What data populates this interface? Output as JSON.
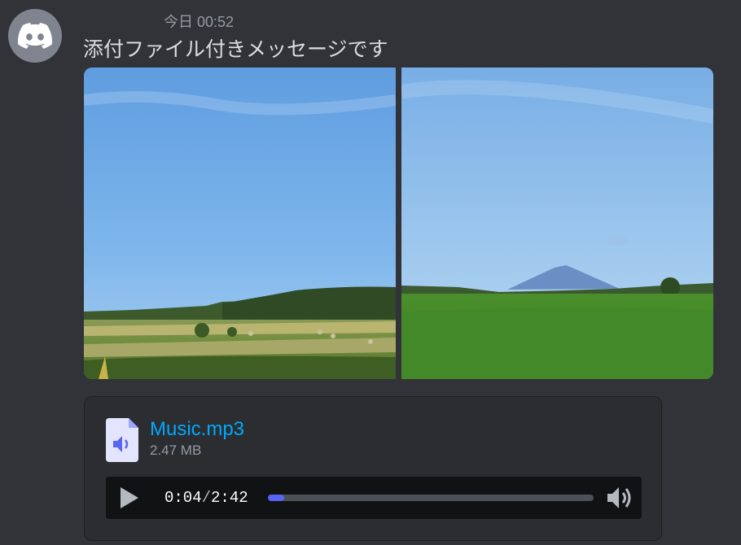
{
  "message": {
    "timestamp": "今日 00:52",
    "content": "添付ファイル付きメッセージです"
  },
  "attachment": {
    "file_name": "Music.mp3",
    "file_size": "2.47 MB",
    "current_time": "0:04",
    "separator": "/",
    "duration": "2:42",
    "progress_fraction": 0.05
  },
  "icons": {
    "avatar": "discord-logo-icon",
    "file": "audio-file-icon",
    "play": "play-icon",
    "volume": "volume-icon"
  },
  "colors": {
    "background": "#313338",
    "link": "#00a8fc",
    "progress_fill": "#5865f2",
    "avatar_bg": "#80848e"
  }
}
